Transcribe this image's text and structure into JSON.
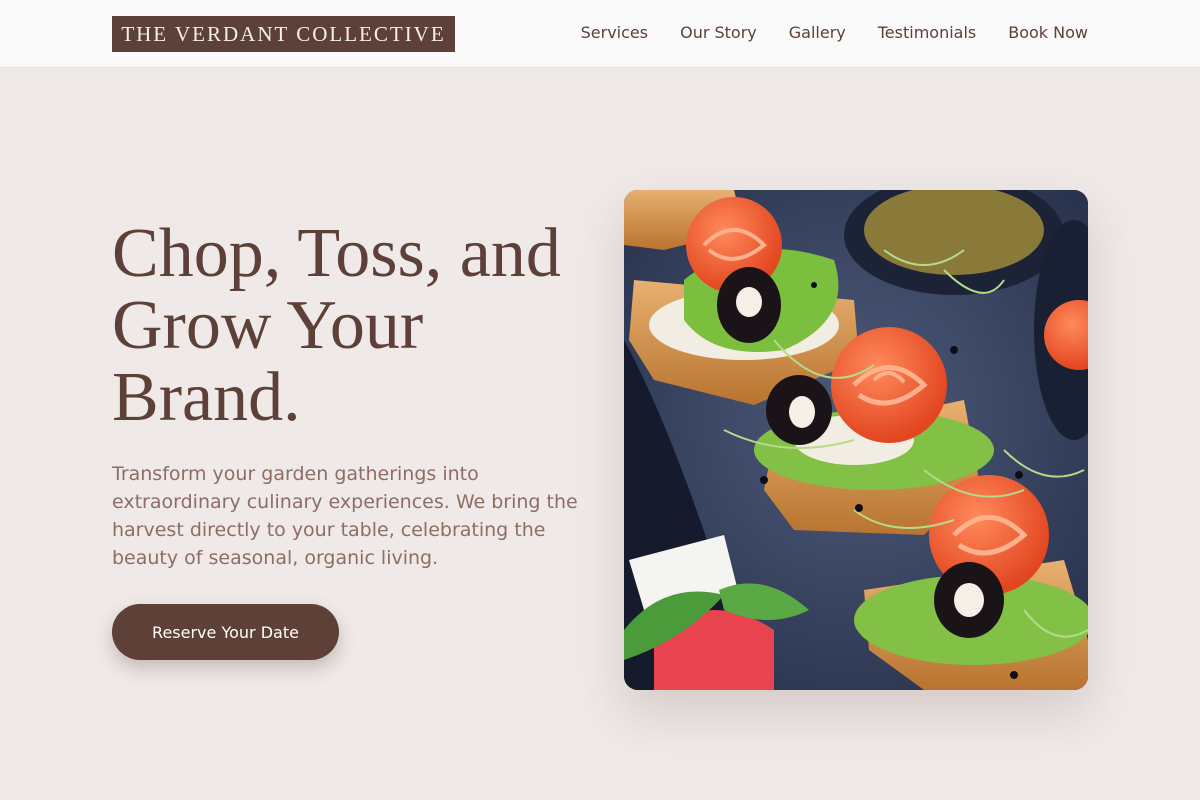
{
  "header": {
    "logo_text": "THE VERDANT COLLECTIVE",
    "nav": [
      {
        "label": "Services"
      },
      {
        "label": "Our Story"
      },
      {
        "label": "Gallery"
      },
      {
        "label": "Testimonials"
      },
      {
        "label": "Book Now"
      }
    ]
  },
  "hero": {
    "title": "Chop, Toss, and Grow Your Brand.",
    "description": "Transform your garden gatherings into extraordinary culinary experiences. We bring the harvest directly to your table, celebrating the beauty of seasonal, organic living.",
    "cta_label": "Reserve Your Date",
    "image_alt": "Canapés with smoked salmon rosettes, black olives and microgreens on a slate board"
  },
  "colors": {
    "brand": "#5d4037",
    "text_muted": "#8d6e63",
    "background": "#efe9e8",
    "header_bg": "#fbfafa"
  }
}
